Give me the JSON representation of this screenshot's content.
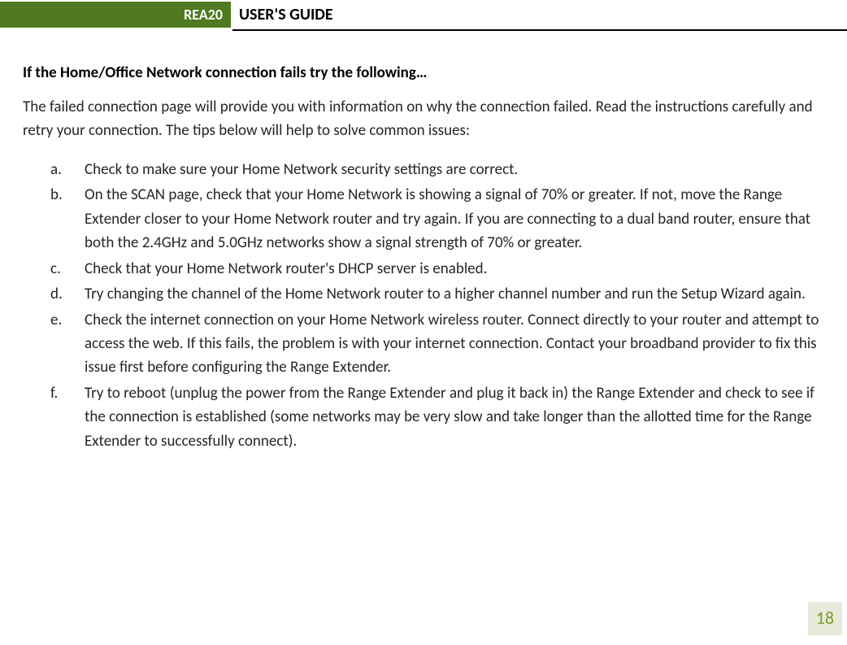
{
  "header": {
    "badge": "REA20",
    "title": "USER'S GUIDE"
  },
  "main": {
    "heading": "If the Home/Office Network connection fails try the following…",
    "intro": "The failed connection page will provide you with information on why the connection failed. Read the instructions carefully and retry your connection. The tips below will help to solve common issues:",
    "items": [
      {
        "marker": "a.",
        "text": "Check to make sure your Home Network security settings are correct."
      },
      {
        "marker": "b.",
        "text": "On the SCAN page, check that your Home Network is showing a signal of 70% or greater. If not, move the Range Extender closer to your Home Network router and try again. If you are connecting to a dual band router, ensure that both the 2.4GHz and 5.0GHz networks show a signal strength of 70% or greater."
      },
      {
        "marker": "c.",
        "text": "Check that your Home Network router's DHCP server is enabled."
      },
      {
        "marker": "d.",
        "text": "Try changing the channel of the Home Network router to a higher channel number and run the Setup Wizard again."
      },
      {
        "marker": "e.",
        "text": "Check the internet connection on your Home Network wireless router. Connect directly to your router and attempt to access the web.  If this fails, the problem is with your internet connection.  Contact your broadband provider to fix this issue first before configuring the Range Extender."
      },
      {
        "marker": "f.",
        "text": "Try to reboot (unplug the power from the Range Extender and plug it back in) the Range Extender and check to see if the connection is established (some networks may be very slow and take longer than the allotted time for the Range Extender to successfully connect)."
      }
    ]
  },
  "footer": {
    "page_number": "18"
  }
}
